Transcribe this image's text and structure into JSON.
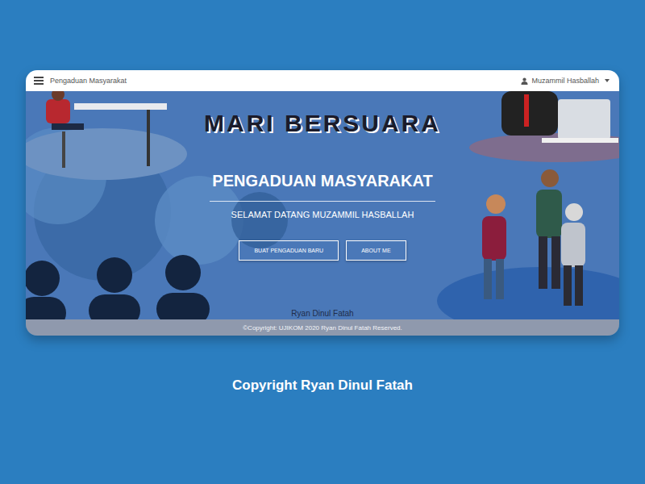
{
  "navbar": {
    "title": "Pengaduan Masyarakat",
    "user": "Muzammil Hasballah"
  },
  "hero": {
    "logo": "MARI BERSUARA",
    "title": "PENGADUAN MASYARAKAT",
    "subtitle": "SELAMAT DATANG MUZAMMIL HASBALLAH",
    "buttons": [
      "BUAT PENGADUAN BARU",
      "ABOUT ME"
    ],
    "author": "Ryan Dinul Fatah"
  },
  "footer": {
    "text": "©Copyright: UJIKOM 2020 Ryan Dinul Fatah Reserved."
  },
  "caption": "Copyright Ryan Dinul Fatah"
}
